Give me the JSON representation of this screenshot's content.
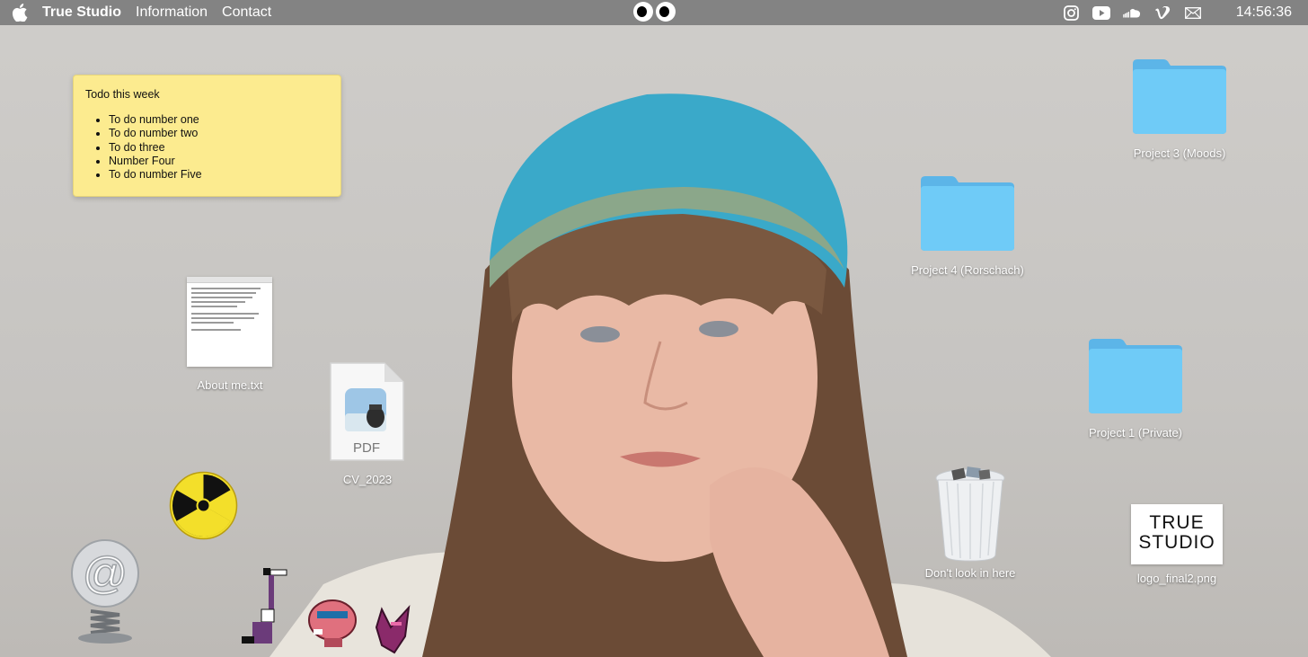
{
  "menubar": {
    "app_name": "True Studio",
    "items": [
      "Information",
      "Contact"
    ],
    "clock": "14:56:36",
    "socials": [
      "instagram-icon",
      "youtube-icon",
      "soundcloud-icon",
      "vimeo-icon",
      "mail-icon"
    ]
  },
  "sticky": {
    "title": "Todo this week",
    "items": [
      "To do number one",
      "To do number two",
      "To do three",
      "Number Four",
      "To do number Five"
    ]
  },
  "desktop": {
    "about_label": "About me.txt",
    "cv_label": "CV_2023",
    "pdf_badge": "PDF",
    "project3_label": "Project 3 (Moods)",
    "project4_label": "Project 4 (Rorschach)",
    "project1_label": "Project 1 (Private)",
    "trash_label": "Don't look in here",
    "logo_label": "logo_final2.png",
    "logo_text_1": "TRUE",
    "logo_text_2": "STUDIO"
  },
  "colors": {
    "folder": "#6cc6f5",
    "sticky": "#fceb8f",
    "menubar": "#7d7d7d",
    "cap": "#3aa9c9"
  }
}
